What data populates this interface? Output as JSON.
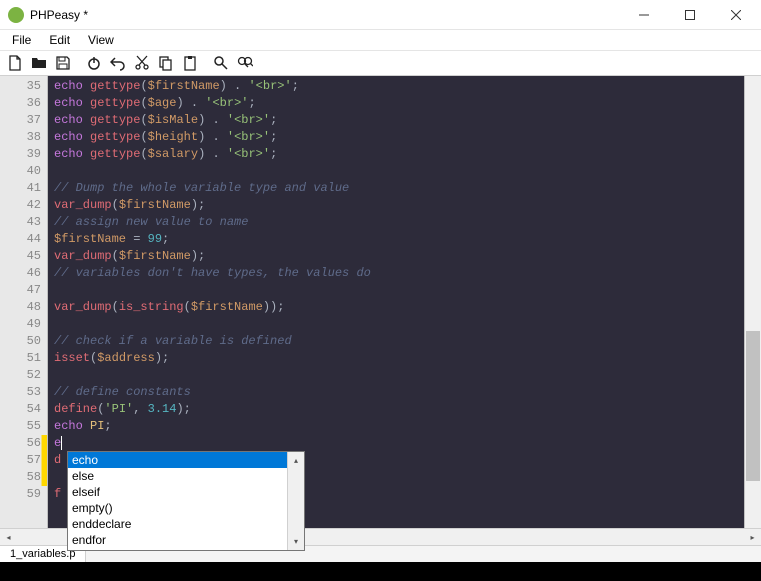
{
  "window": {
    "title": "PHPeasy *"
  },
  "menubar": {
    "items": [
      "File",
      "Edit",
      "View"
    ]
  },
  "toolbar": {
    "items": [
      {
        "name": "new-file-icon",
        "title": "New"
      },
      {
        "name": "open-folder-icon",
        "title": "Open"
      },
      {
        "name": "save-icon",
        "title": "Save"
      },
      {
        "name": "sep"
      },
      {
        "name": "power-icon",
        "title": "Run"
      },
      {
        "name": "undo-icon",
        "title": "Undo"
      },
      {
        "name": "cut-icon",
        "title": "Cut"
      },
      {
        "name": "copy-icon",
        "title": "Copy"
      },
      {
        "name": "paste-icon",
        "title": "Paste"
      },
      {
        "name": "sep"
      },
      {
        "name": "search-icon",
        "title": "Find"
      },
      {
        "name": "replace-icon",
        "title": "Replace"
      }
    ]
  },
  "editor": {
    "gutter_start": 35,
    "modified_lines": [
      56,
      57,
      58
    ],
    "autocomplete": {
      "items": [
        "echo",
        "else",
        "elseif",
        "empty()",
        "enddeclare",
        "endfor"
      ],
      "selected_index": 0
    },
    "lines": [
      [
        [
          "kw",
          "echo"
        ],
        [
          "pun",
          " "
        ],
        [
          "fn",
          "gettype"
        ],
        [
          "pun",
          "("
        ],
        [
          "var",
          "$firstName"
        ],
        [
          "pun",
          ") . "
        ],
        [
          "str",
          "'<br>'"
        ],
        [
          "pun",
          ";"
        ]
      ],
      [
        [
          "kw",
          "echo"
        ],
        [
          "pun",
          " "
        ],
        [
          "fn",
          "gettype"
        ],
        [
          "pun",
          "("
        ],
        [
          "var",
          "$age"
        ],
        [
          "pun",
          ") . "
        ],
        [
          "str",
          "'<br>'"
        ],
        [
          "pun",
          ";"
        ]
      ],
      [
        [
          "kw",
          "echo"
        ],
        [
          "pun",
          " "
        ],
        [
          "fn",
          "gettype"
        ],
        [
          "pun",
          "("
        ],
        [
          "var",
          "$isMale"
        ],
        [
          "pun",
          ") . "
        ],
        [
          "str",
          "'<br>'"
        ],
        [
          "pun",
          ";"
        ]
      ],
      [
        [
          "kw",
          "echo"
        ],
        [
          "pun",
          " "
        ],
        [
          "fn",
          "gettype"
        ],
        [
          "pun",
          "("
        ],
        [
          "var",
          "$height"
        ],
        [
          "pun",
          ") . "
        ],
        [
          "str",
          "'<br>'"
        ],
        [
          "pun",
          ";"
        ]
      ],
      [
        [
          "kw",
          "echo"
        ],
        [
          "pun",
          " "
        ],
        [
          "fn",
          "gettype"
        ],
        [
          "pun",
          "("
        ],
        [
          "var",
          "$salary"
        ],
        [
          "pun",
          ") . "
        ],
        [
          "str",
          "'<br>'"
        ],
        [
          "pun",
          ";"
        ]
      ],
      [],
      [
        [
          "com",
          "// Dump the whole variable type and value"
        ]
      ],
      [
        [
          "fn",
          "var_dump"
        ],
        [
          "pun",
          "("
        ],
        [
          "var",
          "$firstName"
        ],
        [
          "pun",
          ");"
        ]
      ],
      [
        [
          "com",
          "// assign new value to name"
        ]
      ],
      [
        [
          "var",
          "$firstName"
        ],
        [
          "pun",
          " = "
        ],
        [
          "num",
          "99"
        ],
        [
          "pun",
          ";"
        ]
      ],
      [
        [
          "fn",
          "var_dump"
        ],
        [
          "pun",
          "("
        ],
        [
          "var",
          "$firstName"
        ],
        [
          "pun",
          ");"
        ]
      ],
      [
        [
          "com",
          "// variables don't have types, the values do"
        ]
      ],
      [],
      [
        [
          "fn",
          "var_dump"
        ],
        [
          "pun",
          "("
        ],
        [
          "fn",
          "is_string"
        ],
        [
          "pun",
          "("
        ],
        [
          "var",
          "$firstName"
        ],
        [
          "pun",
          "));"
        ]
      ],
      [],
      [
        [
          "com",
          "// check if a variable is defined"
        ]
      ],
      [
        [
          "fn",
          "isset"
        ],
        [
          "pun",
          "("
        ],
        [
          "var",
          "$address"
        ],
        [
          "pun",
          ");"
        ]
      ],
      [],
      [
        [
          "com",
          "// define constants"
        ]
      ],
      [
        [
          "fn",
          "define"
        ],
        [
          "pun",
          "("
        ],
        [
          "str",
          "'PI'"
        ],
        [
          "pun",
          ", "
        ],
        [
          "num",
          "3.14"
        ],
        [
          "pun",
          ");"
        ]
      ],
      [
        [
          "kw",
          "echo"
        ],
        [
          "pun",
          " "
        ],
        [
          "const",
          "PI"
        ],
        [
          "pun",
          ";"
        ]
      ],
      [
        [
          "kw",
          "e"
        ],
        [
          "cursor",
          ""
        ]
      ],
      [
        [
          "fn",
          "d"
        ]
      ],
      [],
      [
        [
          "fn",
          "f"
        ]
      ]
    ]
  },
  "tabs": {
    "items": [
      "1_variables.p"
    ]
  }
}
